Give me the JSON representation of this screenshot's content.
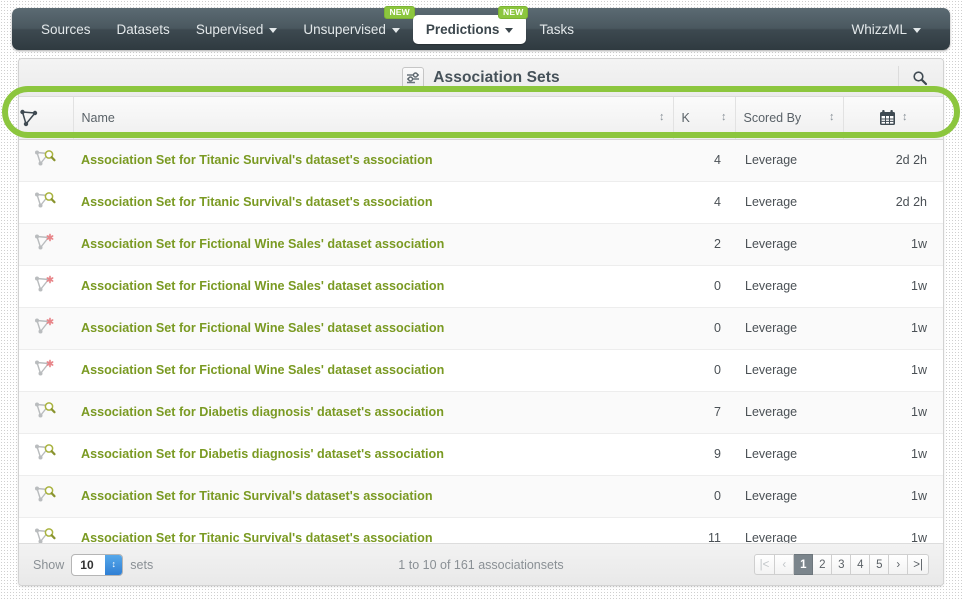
{
  "navbar": {
    "items": [
      {
        "label": "Sources",
        "icon": "none",
        "caret": false,
        "badge": null,
        "active": false
      },
      {
        "label": "Datasets",
        "icon": "none",
        "caret": false,
        "badge": null,
        "active": false
      },
      {
        "label": "Supervised",
        "icon": "chevron-down-icon",
        "caret": true,
        "badge": null,
        "active": false
      },
      {
        "label": "Unsupervised",
        "icon": "chevron-down-icon",
        "caret": true,
        "badge": "NEW",
        "active": false
      },
      {
        "label": "Predictions",
        "icon": "chevron-down-icon",
        "caret": true,
        "badge": "NEW",
        "active": true
      },
      {
        "label": "Tasks",
        "icon": "none",
        "caret": false,
        "badge": null,
        "active": false
      }
    ],
    "account": {
      "label": "WhizzML",
      "caret": true
    }
  },
  "panel": {
    "title": "Association Sets",
    "title_icon": "association-sets-icon",
    "search_icon": "search-icon"
  },
  "table": {
    "headers": {
      "icon": "association-icon",
      "name": "Name",
      "k": "K",
      "scored_by": "Scored By",
      "date": "calendar-icon"
    },
    "rows": [
      {
        "icon": "association-search-icon",
        "name": "Association Set for Titanic Survival's dataset's association",
        "k": "4",
        "scored_by": "Leverage",
        "date": "2d 2h"
      },
      {
        "icon": "association-search-icon",
        "name": "Association Set for Titanic Survival's dataset's association",
        "k": "4",
        "scored_by": "Leverage",
        "date": "2d 2h"
      },
      {
        "icon": "association-error-icon",
        "name": "Association Set for Fictional Wine Sales' dataset association",
        "k": "2",
        "scored_by": "Leverage",
        "date": "1w"
      },
      {
        "icon": "association-error-icon",
        "name": "Association Set for Fictional Wine Sales' dataset association",
        "k": "0",
        "scored_by": "Leverage",
        "date": "1w"
      },
      {
        "icon": "association-error-icon",
        "name": "Association Set for Fictional Wine Sales' dataset association",
        "k": "0",
        "scored_by": "Leverage",
        "date": "1w"
      },
      {
        "icon": "association-error-icon",
        "name": "Association Set for Fictional Wine Sales' dataset association",
        "k": "0",
        "scored_by": "Leverage",
        "date": "1w"
      },
      {
        "icon": "association-search-icon",
        "name": "Association Set for Diabetis diagnosis' dataset's association",
        "k": "7",
        "scored_by": "Leverage",
        "date": "1w"
      },
      {
        "icon": "association-search-icon",
        "name": "Association Set for Diabetis diagnosis' dataset's association",
        "k": "9",
        "scored_by": "Leverage",
        "date": "1w"
      },
      {
        "icon": "association-search-icon",
        "name": "Association Set for Titanic Survival's dataset's association",
        "k": "0",
        "scored_by": "Leverage",
        "date": "1w"
      },
      {
        "icon": "association-search-icon",
        "name": "Association Set for Titanic Survival's dataset's association",
        "k": "11",
        "scored_by": "Leverage",
        "date": "1w"
      }
    ]
  },
  "footer": {
    "show_label": "Show",
    "page_size": "10",
    "sets_label": "sets",
    "range_text": "1 to 10 of 161 associationsets",
    "pager": [
      {
        "label": "|<",
        "name": "pager-first",
        "state": "muted"
      },
      {
        "label": "‹",
        "name": "pager-prev",
        "state": "muted"
      },
      {
        "label": "1",
        "name": "pager-page-1",
        "state": "current"
      },
      {
        "label": "2",
        "name": "pager-page-2",
        "state": "normal"
      },
      {
        "label": "3",
        "name": "pager-page-3",
        "state": "normal"
      },
      {
        "label": "4",
        "name": "pager-page-4",
        "state": "normal"
      },
      {
        "label": "5",
        "name": "pager-page-5",
        "state": "normal"
      },
      {
        "label": "›",
        "name": "pager-next",
        "state": "normal"
      },
      {
        "label": ">|",
        "name": "pager-last",
        "state": "normal"
      }
    ]
  },
  "annotation": {
    "highlight_color": "#8cc63e",
    "target": "table-header-row"
  },
  "colors": {
    "accent_green": "#8cc63e",
    "link_green": "#7a9a22",
    "navbar_dark": "#3d4950",
    "text_dark": "#46525a"
  }
}
